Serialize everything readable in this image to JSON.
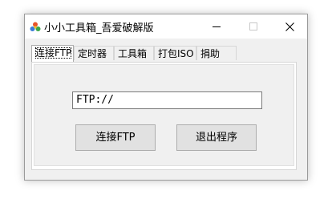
{
  "window": {
    "title": "小小工具箱_吾爱破解版",
    "icon": "app-logo-icon",
    "controls": {
      "minimize": "minimize-icon",
      "maximize": "maximize-icon",
      "close": "close-icon"
    }
  },
  "tabs": [
    {
      "label": "连接FTP",
      "active": true
    },
    {
      "label": "定时器"
    },
    {
      "label": "工具箱"
    },
    {
      "label": "打包ISO"
    },
    {
      "label": "捐助"
    }
  ],
  "ftp": {
    "value": "FTP://"
  },
  "buttons": {
    "connect": "连接FTP",
    "exit": "退出程序"
  },
  "colors": {
    "window_bg": "#f0f0f0",
    "button_bg": "#e1e1e1",
    "border": "#adadad"
  }
}
